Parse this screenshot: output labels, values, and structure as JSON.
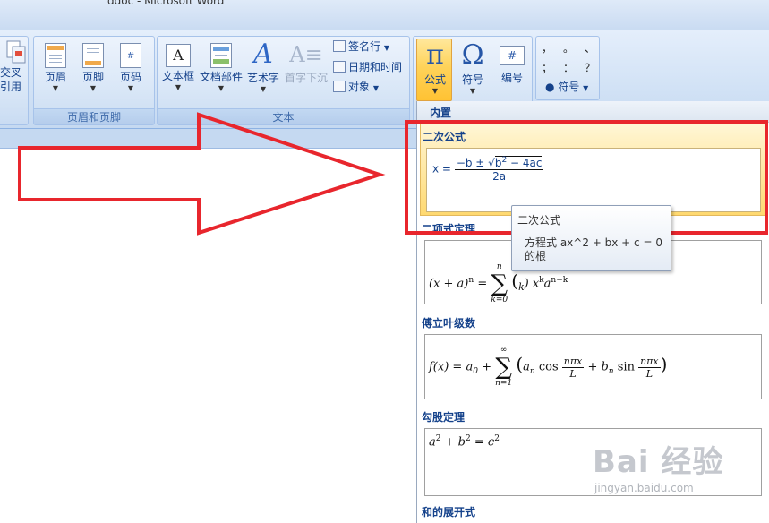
{
  "window": {
    "title": "ddoc - Microsoft Word"
  },
  "ribbon": {
    "partial_button": {
      "line1": "交叉",
      "line2": "引用"
    },
    "header_footer_group": {
      "label": "页眉和页脚",
      "buttons": [
        "页眉",
        "页脚",
        "页码"
      ]
    },
    "text_group": {
      "label": "文本",
      "buttons": [
        "文本框",
        "文档部件",
        "艺术字",
        "首字下沉"
      ],
      "small_buttons": [
        "签名行",
        "日期和时间",
        "对象"
      ]
    },
    "symbols_group": {
      "equation": {
        "glyph": "π",
        "label": "公式"
      },
      "symbol": {
        "glyph": "Ω",
        "label": "符号"
      },
      "number": {
        "glyph": "#",
        "label": "编号"
      }
    },
    "special_chars": {
      "row1": [
        "，",
        "。",
        "、"
      ],
      "row2": [
        "；",
        "：",
        "？"
      ],
      "symbol_label": "符号"
    }
  },
  "gallery": {
    "header": "内置",
    "items": [
      {
        "label": "二次公式",
        "selected": true
      },
      {
        "label": "二项式定理"
      },
      {
        "label": "傅立叶级数"
      },
      {
        "label": "勾股定理"
      },
      {
        "label": "和的展开式"
      }
    ]
  },
  "tooltip": {
    "title": "二次公式",
    "description": "方程式 ax^2 + bx + c = 0 的根"
  },
  "watermark": {
    "logo": "Bai 经验",
    "url": "jingyan.baidu.com"
  },
  "colors": {
    "highlight": "#e8262d",
    "ribbon": "#d3e3f6",
    "selected": "#ffd970"
  }
}
